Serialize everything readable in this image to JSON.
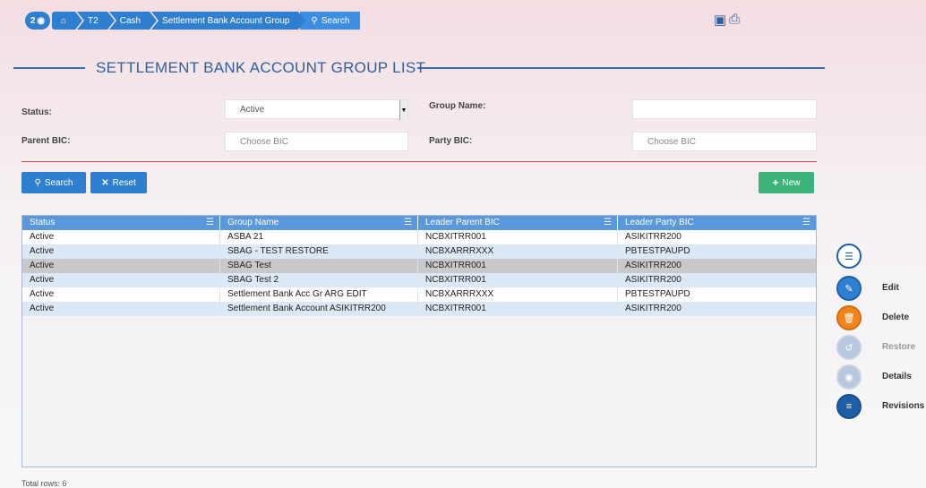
{
  "breadcrumb": {
    "badge": "2",
    "items": [
      "T2",
      "Cash",
      "Settlement Bank Account Group",
      "Search"
    ]
  },
  "title": "SETTLEMENT BANK ACCOUNT GROUP LIST",
  "filters": {
    "status_label": "Status:",
    "status_value": "Active",
    "group_name_label": "Group Name:",
    "group_name_value": "",
    "parent_bic_label": "Parent BIC:",
    "parent_bic_placeholder": "Choose BIC",
    "party_bic_label": "Party BIC:",
    "party_bic_placeholder": "Choose BIC"
  },
  "buttons": {
    "search": "Search",
    "reset": "Reset",
    "new": "New"
  },
  "table": {
    "headers": [
      "Status",
      "Group Name",
      "Leader Parent BIC",
      "Leader Party BIC"
    ],
    "rows": [
      [
        "Active",
        "ASBA 21",
        "NCBXITRR001",
        "ASIKITRR200"
      ],
      [
        "Active",
        "SBAG - TEST RESTORE",
        "NCBXARRRXXX",
        "PBTESTPAUPD"
      ],
      [
        "Active",
        "SBAG Test",
        "NCBXITRR001",
        "ASIKITRR200"
      ],
      [
        "Active",
        "SBAG Test 2",
        "NCBXITRR001",
        "ASIKITRR200"
      ],
      [
        "Active",
        "Settlement Bank Acc Gr ARG EDIT",
        "NCBXARRRXXX",
        "PBTESTPAUPD"
      ],
      [
        "Active",
        "Settlement Bank Account ASIKITRR200",
        "NCBXITRR001",
        "ASIKITRR200"
      ]
    ],
    "selected_row": 2
  },
  "total_rows": "Total rows: 6",
  "actions": {
    "edit": "Edit",
    "delete": "Delete",
    "restore": "Restore",
    "details": "Details",
    "revisions": "Revisions"
  },
  "colors": {
    "primary": "#2f7fd1",
    "green": "#3cb37a",
    "orange": "#f0831a",
    "navy": "#1f5fa8",
    "disabled": "#b8c8de"
  }
}
